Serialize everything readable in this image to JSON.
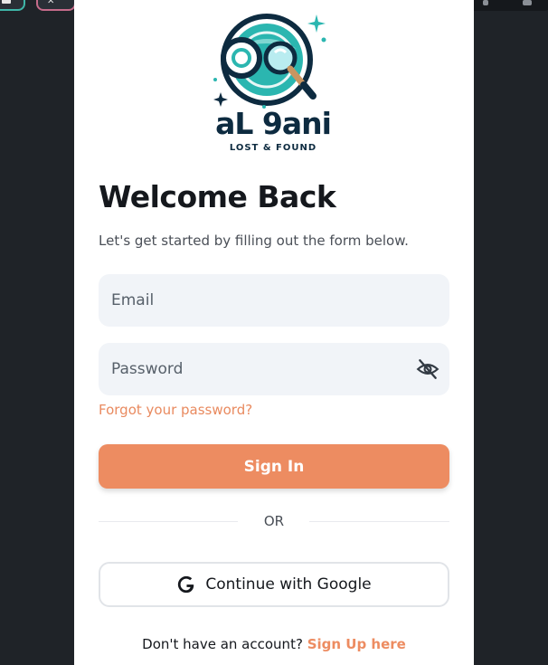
{
  "branding": {
    "name": "aL 9ani",
    "tagline": "LOST & FOUND",
    "colors": {
      "navy": "#0d2b40",
      "teal": "#2bb6b0",
      "accent": "#ed8c61"
    }
  },
  "login": {
    "title": "Welcome Back",
    "subtitle": "Let's get started by filling out the form below.",
    "email_placeholder": "Email",
    "password_placeholder": "Password",
    "password_toggle_icon": "eye-off-icon",
    "forgot_label": "Forgot your password?",
    "signin_label": "Sign In",
    "or_label": "OR",
    "google_label": "Continue with Google",
    "google_icon": "google-g-icon",
    "signup_prompt": "Don't have an account?",
    "signup_link": "Sign Up here"
  }
}
